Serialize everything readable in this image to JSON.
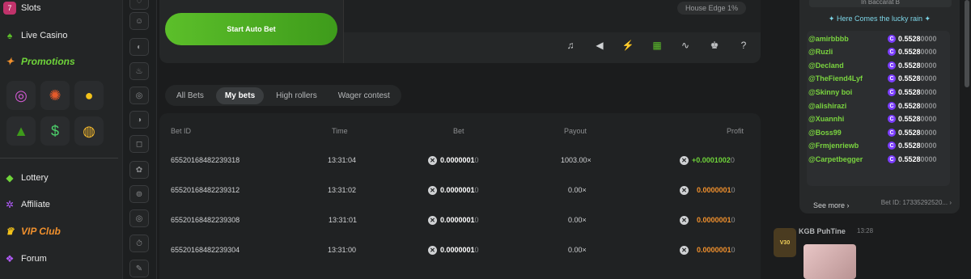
{
  "sidebar": {
    "items": [
      {
        "label": "Slots",
        "icon": "slot-icon"
      },
      {
        "label": "Live Casino",
        "icon": "dealer-icon"
      },
      {
        "label": "Promotions",
        "icon": "gift-icon"
      },
      {
        "label": "Lottery",
        "icon": "ticket-icon"
      },
      {
        "label": "Affiliate",
        "icon": "network-icon"
      },
      {
        "label": "VIP Club",
        "icon": "crown-icon"
      },
      {
        "label": "Forum",
        "icon": "forum-icon"
      }
    ]
  },
  "game": {
    "auto_bet_label": "Start Auto Bet",
    "house_edge": "House Edge 1%"
  },
  "tabs": [
    "All Bets",
    "My bets",
    "High rollers",
    "Wager contest"
  ],
  "active_tab": "My bets",
  "table": {
    "headers": {
      "bet_id": "Bet ID",
      "time": "Time",
      "bet": "Bet",
      "payout": "Payout",
      "profit": "Profit"
    },
    "rows": [
      {
        "id": "65520168482239318",
        "time": "13:31:04",
        "bet_main": "0.0000001",
        "bet_tail": "0",
        "payout": "1003.00×",
        "profit_main": "+0.0001002",
        "profit_tail": "0",
        "profit_type": "pos"
      },
      {
        "id": "65520168482239312",
        "time": "13:31:02",
        "bet_main": "0.0000001",
        "bet_tail": "0",
        "payout": "0.00×",
        "profit_main": "0.0000001",
        "profit_tail": "0",
        "profit_type": "neg"
      },
      {
        "id": "65520168482239308",
        "time": "13:31:01",
        "bet_main": "0.0000001",
        "bet_tail": "0",
        "payout": "0.00×",
        "profit_main": "0.0000001",
        "profit_tail": "0",
        "profit_type": "neg"
      },
      {
        "id": "65520168482239304",
        "time": "13:31:00",
        "bet_main": "0.0000001",
        "bet_tail": "0",
        "payout": "0.00×",
        "profit_main": "0.0000001",
        "profit_tail": "0",
        "profit_type": "neg"
      }
    ]
  },
  "rain": {
    "header": "In Baccarat B",
    "title": "Here Comes the lucky rain",
    "winners": [
      {
        "name": "@amirbbbb",
        "amount_main": "0.5528",
        "amount_tail": "0000"
      },
      {
        "name": "@Ruzli",
        "amount_main": "0.5528",
        "amount_tail": "0000"
      },
      {
        "name": "@Decland",
        "amount_main": "0.5528",
        "amount_tail": "0000"
      },
      {
        "name": "@TheFiend4Lyf",
        "amount_main": "0.5528",
        "amount_tail": "0000"
      },
      {
        "name": "@Skinny boi",
        "amount_main": "0.5528",
        "amount_tail": "0000"
      },
      {
        "name": "@alishirazi",
        "amount_main": "0.5528",
        "amount_tail": "0000"
      },
      {
        "name": "@Xuannhi",
        "amount_main": "0.5528",
        "amount_tail": "0000"
      },
      {
        "name": "@Boss99",
        "amount_main": "0.5528",
        "amount_tail": "0000"
      },
      {
        "name": "@Frmjenriewb",
        "amount_main": "0.5528",
        "amount_tail": "0000"
      },
      {
        "name": "@Carpetbegger",
        "amount_main": "0.5528",
        "amount_tail": "0000"
      }
    ],
    "see_more": "See more",
    "bet_id": "Bet ID: 17335292520..."
  },
  "chat_message": {
    "user": "KGB PuhTine",
    "time": "13:28",
    "vip_badge": "V30"
  },
  "colors": {
    "accent_green": "#5cbf2a",
    "profit_positive": "#6fd43a",
    "profit_negative": "#f0902d",
    "rain_user": "#7ad43f"
  }
}
